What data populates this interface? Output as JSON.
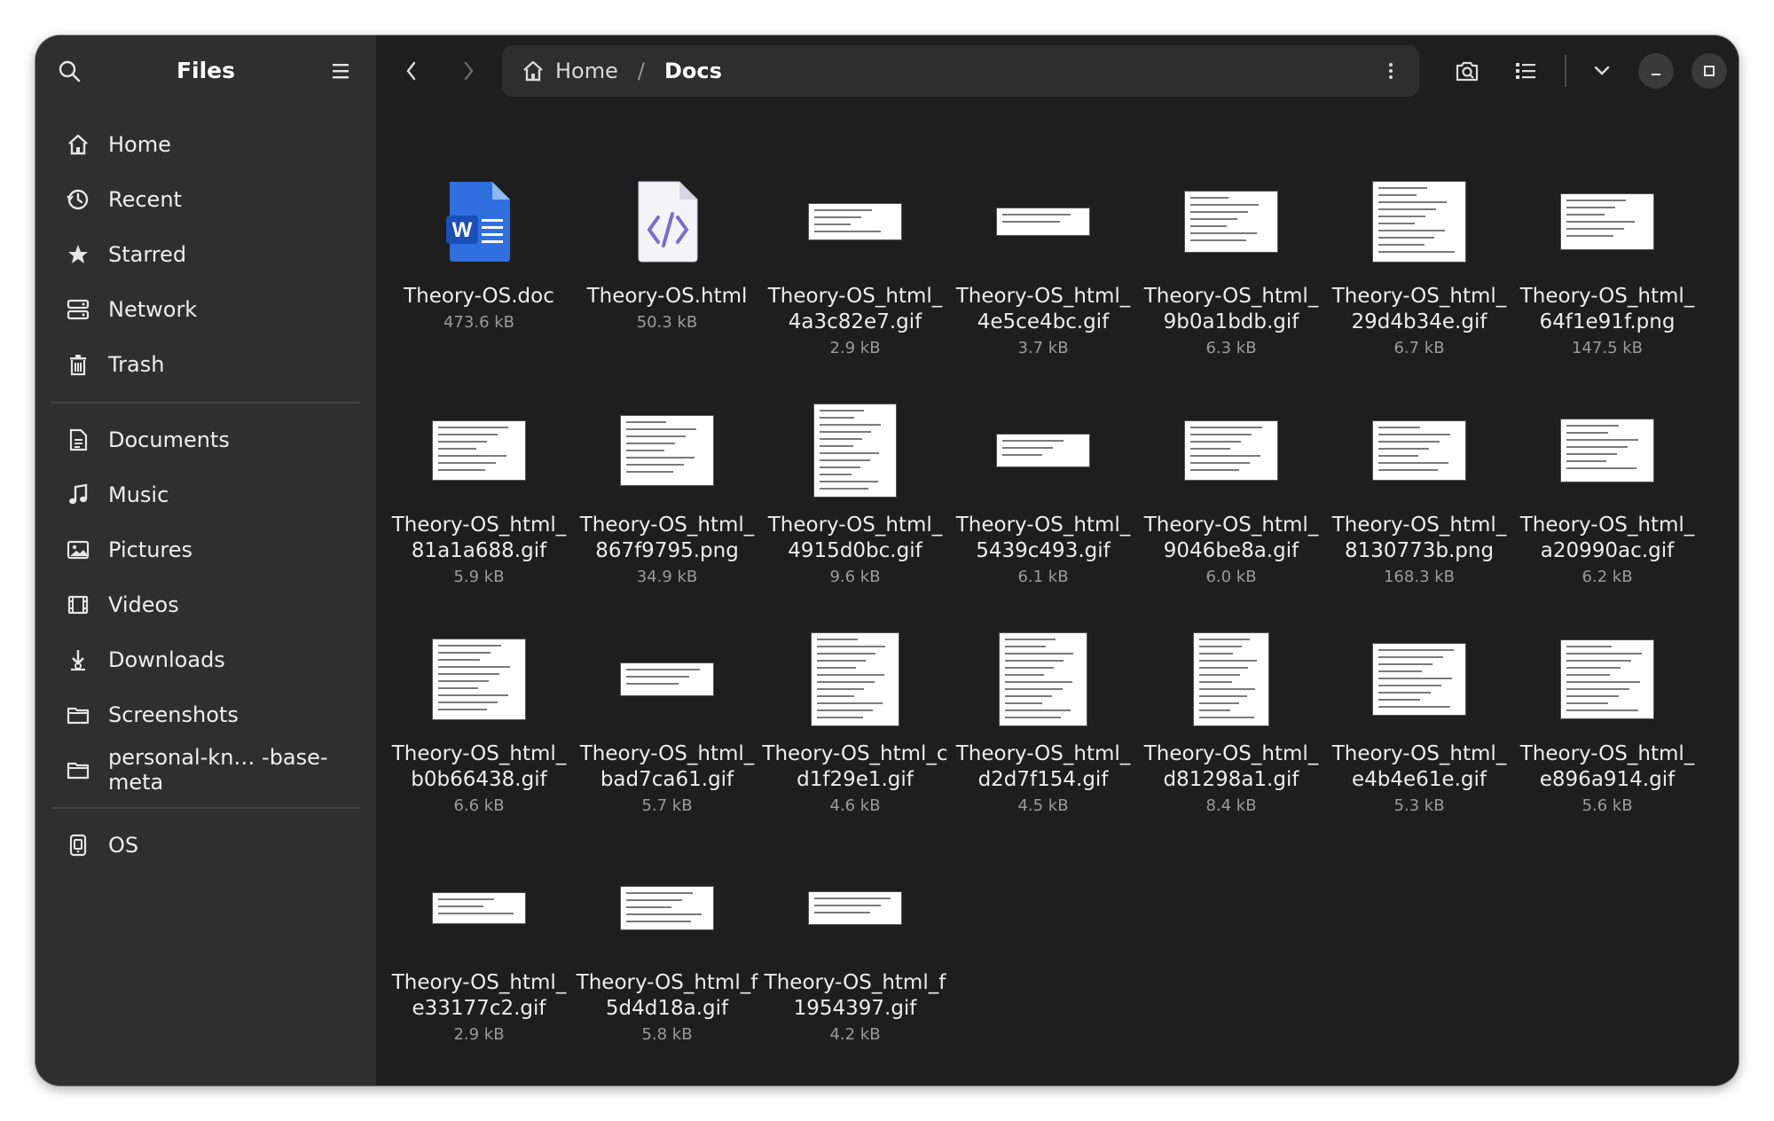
{
  "sidebar": {
    "title": "Files",
    "items": [
      {
        "label": "Home",
        "icon": "home-icon"
      },
      {
        "label": "Recent",
        "icon": "clock-icon"
      },
      {
        "label": "Starred",
        "icon": "star-icon"
      },
      {
        "label": "Network",
        "icon": "network-icon"
      },
      {
        "label": "Trash",
        "icon": "trash-icon"
      }
    ],
    "places": [
      {
        "label": "Documents",
        "icon": "document-icon"
      },
      {
        "label": "Music",
        "icon": "music-icon"
      },
      {
        "label": "Pictures",
        "icon": "picture-icon"
      },
      {
        "label": "Videos",
        "icon": "video-icon"
      },
      {
        "label": "Downloads",
        "icon": "download-icon"
      },
      {
        "label": "Screenshots",
        "icon": "folder-icon"
      },
      {
        "label": "personal-kn… -base-meta",
        "icon": "folder-icon"
      }
    ],
    "devices": [
      {
        "label": "OS",
        "icon": "drive-icon"
      }
    ]
  },
  "pathbar": {
    "home": "Home",
    "separator": "/",
    "current": "Docs"
  },
  "files": [
    {
      "name": "Theory-OS.doc",
      "size": "473.6 kB",
      "kind": "doc"
    },
    {
      "name": "Theory-OS.html",
      "size": "50.3 kB",
      "kind": "html"
    },
    {
      "name": "Theory-OS_html_4a3c82e7.gif",
      "size": "2.9 kB",
      "kind": "img"
    },
    {
      "name": "Theory-OS_html_4e5ce4bc.gif",
      "size": "3.7 kB",
      "kind": "img"
    },
    {
      "name": "Theory-OS_html_9b0a1bdb.gif",
      "size": "6.3 kB",
      "kind": "img"
    },
    {
      "name": "Theory-OS_html_29d4b34e.gif",
      "size": "6.7 kB",
      "kind": "img"
    },
    {
      "name": "Theory-OS_html_64f1e91f.png",
      "size": "147.5 kB",
      "kind": "img"
    },
    {
      "name": "Theory-OS_html_81a1a688.gif",
      "size": "5.9 kB",
      "kind": "img"
    },
    {
      "name": "Theory-OS_html_867f9795.png",
      "size": "34.9 kB",
      "kind": "img"
    },
    {
      "name": "Theory-OS_html_4915d0bc.gif",
      "size": "9.6 kB",
      "kind": "img"
    },
    {
      "name": "Theory-OS_html_5439c493.gif",
      "size": "6.1 kB",
      "kind": "img"
    },
    {
      "name": "Theory-OS_html_9046be8a.gif",
      "size": "6.0 kB",
      "kind": "img"
    },
    {
      "name": "Theory-OS_html_8130773b.png",
      "size": "168.3 kB",
      "kind": "img"
    },
    {
      "name": "Theory-OS_html_a20990ac.gif",
      "size": "6.2 kB",
      "kind": "img"
    },
    {
      "name": "Theory-OS_html_b0b66438.gif",
      "size": "6.6 kB",
      "kind": "img"
    },
    {
      "name": "Theory-OS_html_bad7ca61.gif",
      "size": "5.7 kB",
      "kind": "img"
    },
    {
      "name": "Theory-OS_html_cd1f29e1.gif",
      "size": "4.6 kB",
      "kind": "img"
    },
    {
      "name": "Theory-OS_html_d2d7f154.gif",
      "size": "4.5 kB",
      "kind": "img"
    },
    {
      "name": "Theory-OS_html_d81298a1.gif",
      "size": "8.4 kB",
      "kind": "img"
    },
    {
      "name": "Theory-OS_html_e4b4e61e.gif",
      "size": "5.3 kB",
      "kind": "img"
    },
    {
      "name": "Theory-OS_html_e896a914.gif",
      "size": "5.6 kB",
      "kind": "img"
    },
    {
      "name": "Theory-OS_html_e33177c2.gif",
      "size": "2.9 kB",
      "kind": "img"
    },
    {
      "name": "Theory-OS_html_f5d4d18a.gif",
      "size": "5.8 kB",
      "kind": "img"
    },
    {
      "name": "Theory-OS_html_f1954397.gif",
      "size": "4.2 kB",
      "kind": "img"
    }
  ],
  "colors": {
    "window_bg": "#1e1e1e",
    "sidebar_bg": "#2f2f2f",
    "pathbar_bg": "#2e2e2e",
    "doc_blue": "#2f6fe0",
    "html_purple": "#7a6ad8"
  }
}
